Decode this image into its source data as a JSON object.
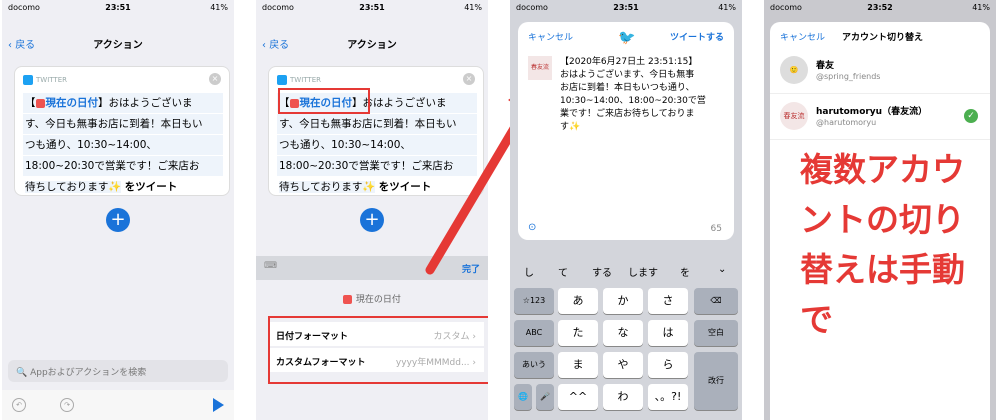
{
  "status": [
    {
      "carrier": "docomo",
      "time": "23:51",
      "battery": "41%"
    },
    {
      "carrier": "docomo",
      "time": "23:51",
      "battery": "41%"
    },
    {
      "carrier": "docomo",
      "time": "23:51",
      "battery": "41%"
    },
    {
      "carrier": "docomo",
      "time": "23:52",
      "battery": "41%"
    }
  ],
  "action": {
    "back": "戻る",
    "title": "アクション",
    "source": "TWITTER",
    "lines": [
      "【",
      "現在の日付",
      "】おはようございま",
      "す、今日も無事お店に到着！本日もい",
      "つも通り、10:30~14:00、",
      "18:00~20:30で営業です！ご来店お",
      "待ちしております✨",
      "をツイート"
    ],
    "search_placeholder": "Appおよびアクションを検索"
  },
  "panel2": {
    "done": "完了",
    "token_title": "現在の日付",
    "rows": [
      {
        "label": "日付フォーマット",
        "value": "カスタム"
      },
      {
        "label": "カスタムフォーマット",
        "value": "yyyy年MMMdd..."
      }
    ]
  },
  "tweet": {
    "cancel": "キャンセル",
    "tweet_button": "ツイートする",
    "text_lines": [
      "【2020年6月27日土 23:51:15】",
      "おはようございます、今日も無事",
      "お店に到着！本日もいつも通り、",
      "10:30~14:00、18:00~20:30で営",
      "業です！ご来店お待ちしておりま",
      "す✨"
    ],
    "count": "65"
  },
  "keyboard": {
    "candidates": [
      "し",
      "て",
      "する",
      "します",
      "を"
    ],
    "keys": [
      [
        "☆123",
        "あ",
        "か",
        "さ",
        "⌫"
      ],
      [
        "ABC",
        "た",
        "な",
        "は",
        "空白"
      ],
      [
        "あいう",
        "ま",
        "や",
        "ら",
        "改行"
      ],
      [
        "🌐",
        "🎤",
        "^^",
        "わ",
        "、。?!"
      ]
    ]
  },
  "accounts": {
    "cancel": "キャンセル",
    "title": "アカウント切り替え",
    "list": [
      {
        "name": "春友",
        "handle": "@spring_friends",
        "selected": false
      },
      {
        "name": "harutomoryu（春友流）",
        "handle": "@harutomoryu",
        "selected": true
      }
    ],
    "annotation": [
      "複数アカウ",
      "ントの切り",
      "替えは手動",
      "で"
    ]
  },
  "colors": {
    "accent": "#1a73d9",
    "red": "#e53935",
    "twitter": "#1da1f2"
  }
}
